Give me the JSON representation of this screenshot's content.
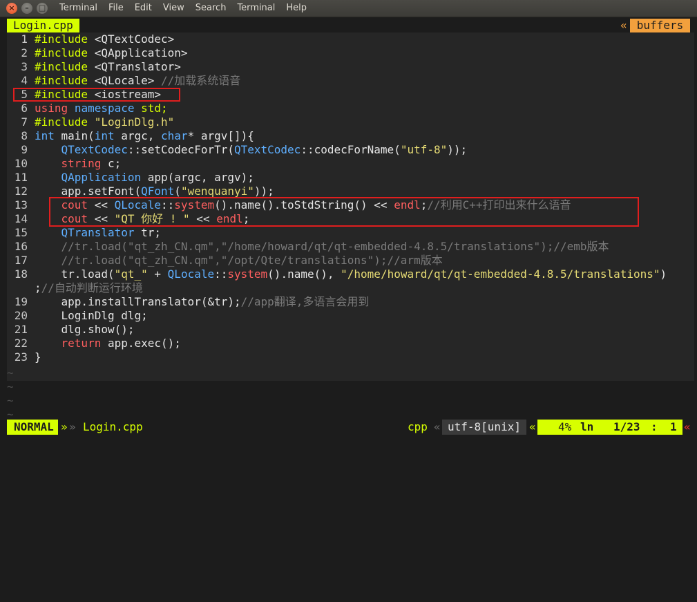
{
  "menubar": {
    "items": [
      "Terminal",
      "File",
      "Edit",
      "View",
      "Search",
      "Terminal",
      "Help"
    ]
  },
  "tabline": {
    "tab_label": "Login.cpp",
    "buffers_separator": "«",
    "buffers_label": "buffers"
  },
  "code_lines": [
    {
      "num": "1",
      "tokens": [
        {
          "t": "#include",
          "c": "pre"
        },
        {
          "t": " <QTextCodec>",
          "c": "id"
        }
      ]
    },
    {
      "num": "2",
      "tokens": [
        {
          "t": "#include",
          "c": "pre"
        },
        {
          "t": " <QApplication>",
          "c": "id"
        }
      ]
    },
    {
      "num": "3",
      "tokens": [
        {
          "t": "#include",
          "c": "pre"
        },
        {
          "t": " <QTranslator>",
          "c": "id"
        }
      ]
    },
    {
      "num": "4",
      "tokens": [
        {
          "t": "#include",
          "c": "pre"
        },
        {
          "t": " <QLocale> ",
          "c": "id"
        },
        {
          "t": "//加载系统语音",
          "c": "cm"
        }
      ]
    },
    {
      "num": "5",
      "tokens": [
        {
          "t": "#include",
          "c": "pre"
        },
        {
          "t": " <iostream>",
          "c": "id"
        }
      ]
    },
    {
      "num": "6",
      "tokens": [
        {
          "t": "using",
          "c": "kw"
        },
        {
          "t": " ",
          "c": "id"
        },
        {
          "t": "namespace",
          "c": "type"
        },
        {
          "t": " std;",
          "c": "pre"
        }
      ]
    },
    {
      "num": "7",
      "tokens": [
        {
          "t": "#include",
          "c": "pre"
        },
        {
          "t": " ",
          "c": "id"
        },
        {
          "t": "\"LoginDlg.h\"",
          "c": "str"
        }
      ]
    },
    {
      "num": "8",
      "tokens": [
        {
          "t": "int",
          "c": "type"
        },
        {
          "t": " main(",
          "c": "id"
        },
        {
          "t": "int",
          "c": "type"
        },
        {
          "t": " argc, ",
          "c": "id"
        },
        {
          "t": "char",
          "c": "type"
        },
        {
          "t": "* argv[]){",
          "c": "id"
        }
      ]
    },
    {
      "num": "9",
      "tokens": [
        {
          "t": "    ",
          "c": "id"
        },
        {
          "t": "QTextCodec",
          "c": "type"
        },
        {
          "t": "::setCodecForTr(",
          "c": "id"
        },
        {
          "t": "QTextCodec",
          "c": "type"
        },
        {
          "t": "::codecForName(",
          "c": "id"
        },
        {
          "t": "\"utf-8\"",
          "c": "str"
        },
        {
          "t": "));",
          "c": "id"
        }
      ]
    },
    {
      "num": "10",
      "tokens": [
        {
          "t": "    ",
          "c": "id"
        },
        {
          "t": "string",
          "c": "kw"
        },
        {
          "t": " c;",
          "c": "id"
        }
      ]
    },
    {
      "num": "11",
      "tokens": [
        {
          "t": "    ",
          "c": "id"
        },
        {
          "t": "QApplication",
          "c": "type"
        },
        {
          "t": " app(argc, argv);",
          "c": "id"
        }
      ]
    },
    {
      "num": "12",
      "tokens": [
        {
          "t": "    app.setFont(",
          "c": "id"
        },
        {
          "t": "QFont",
          "c": "type"
        },
        {
          "t": "(",
          "c": "id"
        },
        {
          "t": "\"wenquanyi\"",
          "c": "str"
        },
        {
          "t": "));",
          "c": "id"
        }
      ]
    },
    {
      "num": "13",
      "tokens": [
        {
          "t": "    ",
          "c": "id"
        },
        {
          "t": "cout",
          "c": "kw"
        },
        {
          "t": " << ",
          "c": "id"
        },
        {
          "t": "QLocale",
          "c": "type"
        },
        {
          "t": "::",
          "c": "id"
        },
        {
          "t": "system",
          "c": "kw"
        },
        {
          "t": "().name().toStdString() << ",
          "c": "id"
        },
        {
          "t": "endl",
          "c": "kw"
        },
        {
          "t": ";",
          "c": "id"
        },
        {
          "t": "//利用C++打印出来什么语音",
          "c": "cm"
        }
      ]
    },
    {
      "num": "14",
      "tokens": [
        {
          "t": "    ",
          "c": "id"
        },
        {
          "t": "cout",
          "c": "kw"
        },
        {
          "t": " << ",
          "c": "id"
        },
        {
          "t": "\"QT 你好 ! \"",
          "c": "str"
        },
        {
          "t": " << ",
          "c": "id"
        },
        {
          "t": "endl",
          "c": "kw"
        },
        {
          "t": ";",
          "c": "id"
        }
      ]
    },
    {
      "num": "15",
      "tokens": [
        {
          "t": "    ",
          "c": "id"
        },
        {
          "t": "QTranslator",
          "c": "type"
        },
        {
          "t": " tr;",
          "c": "id"
        }
      ]
    },
    {
      "num": "16",
      "tokens": [
        {
          "t": "    //tr.load(\"qt_zh_CN.qm\",\"/home/howard/qt/qt-embedded-4.8.5/translations\");//emb版本",
          "c": "cm"
        }
      ]
    },
    {
      "num": "17",
      "tokens": [
        {
          "t": "    //tr.load(\"qt_zh_CN.qm\",\"/opt/Qte/translations\");//arm版本",
          "c": "cm"
        }
      ]
    },
    {
      "num": "18",
      "tokens": [
        {
          "t": "    tr.load(",
          "c": "id"
        },
        {
          "t": "\"qt_\"",
          "c": "str"
        },
        {
          "t": " + ",
          "c": "id"
        },
        {
          "t": "QLocale",
          "c": "type"
        },
        {
          "t": "::",
          "c": "id"
        },
        {
          "t": "system",
          "c": "kw"
        },
        {
          "t": "().name(), ",
          "c": "id"
        },
        {
          "t": "\"/home/howard/qt/qt-embedded-4.8.5/translations\"",
          "c": "str"
        },
        {
          "t": ")",
          "c": "id"
        }
      ]
    },
    {
      "num": "",
      "tokens": [
        {
          "t": ";",
          "c": "id"
        },
        {
          "t": "//自动判断运行环境",
          "c": "cm"
        }
      ]
    },
    {
      "num": "19",
      "tokens": [
        {
          "t": "    app.installTranslator(&tr);",
          "c": "id"
        },
        {
          "t": "//app翻译,多语言会用到",
          "c": "cm"
        }
      ]
    },
    {
      "num": "20",
      "tokens": [
        {
          "t": "    LoginDlg dlg;",
          "c": "id"
        }
      ]
    },
    {
      "num": "21",
      "tokens": [
        {
          "t": "    dlg.show();",
          "c": "id"
        }
      ]
    },
    {
      "num": "22",
      "tokens": [
        {
          "t": "    ",
          "c": "id"
        },
        {
          "t": "return",
          "c": "kw"
        },
        {
          "t": " app.exec();",
          "c": "id"
        }
      ]
    },
    {
      "num": "23",
      "tokens": [
        {
          "t": "}",
          "c": "id"
        }
      ]
    }
  ],
  "filler_lines": [
    "~",
    "~",
    "~",
    "~"
  ],
  "statusline": {
    "mode": "NORMAL",
    "mode_separator": "»",
    "file_separator": "»",
    "filename": "Login.cpp",
    "filetype": "cpp",
    "filetype_separator": "«",
    "encoding": "utf-8[unix]",
    "encoding_separator": "«",
    "percent": "4%",
    "ln_label": "ln",
    "line_pos": "1/23",
    "colon": ":",
    "column": "1",
    "end_separator": "«"
  },
  "colors": {
    "accent_yellow": "#d7ff00",
    "buffers_orange": "#f2a03d",
    "highlight_red": "#e01e1e",
    "background": "#1c1c1c"
  },
  "icons": {
    "close": "close-icon",
    "minimize": "minimize-icon",
    "maximize": "maximize-icon"
  }
}
